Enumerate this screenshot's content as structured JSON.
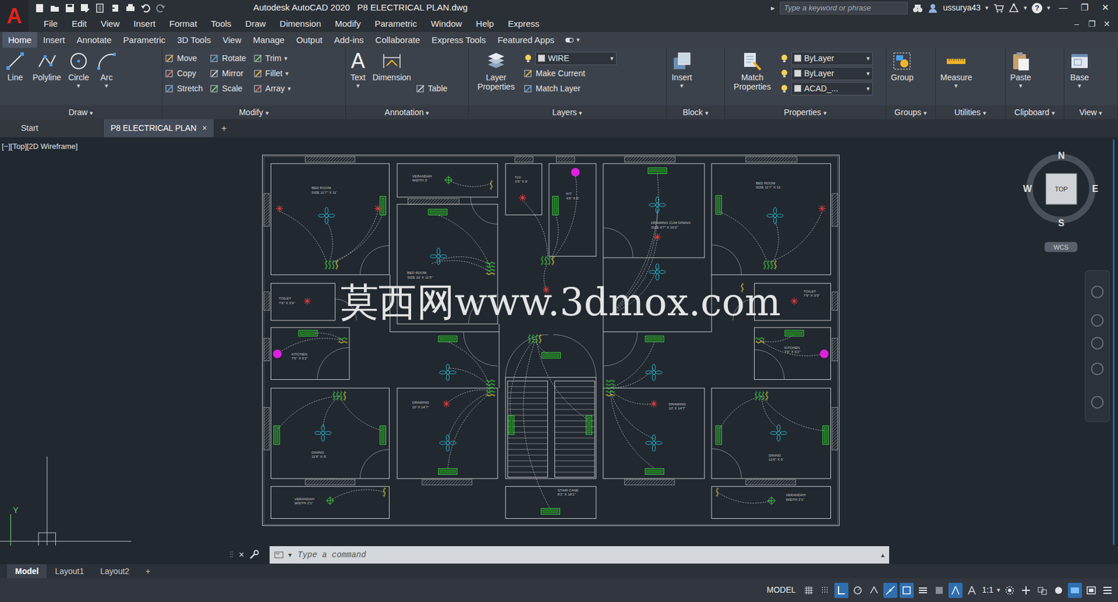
{
  "window": {
    "logo": "A",
    "title": "Autodesk AutoCAD 2020   P8 ELECTRICAL PLAN.dwg",
    "search_arrow": "▸",
    "search_placeholder": "Type a keyword or phrase",
    "user": "ussurya43",
    "help": "?",
    "controls": [
      "—",
      "❐",
      "✕"
    ]
  },
  "dropdown_glyph": "▾",
  "menu": {
    "items": [
      "File",
      "Edit",
      "View",
      "Insert",
      "Format",
      "Tools",
      "Draw",
      "Dimension",
      "Modify",
      "Parametric",
      "Window",
      "Help",
      "Express"
    ],
    "controls": [
      "–",
      "❐",
      "✕"
    ]
  },
  "ribbon_tabs": [
    {
      "label": "Home",
      "selected": true
    },
    {
      "label": "Insert",
      "selected": false
    },
    {
      "label": "Annotate",
      "selected": false
    },
    {
      "label": "Parametric",
      "selected": false
    },
    {
      "label": "3D Tools",
      "selected": false
    },
    {
      "label": "View",
      "selected": false
    },
    {
      "label": "Manage",
      "selected": false
    },
    {
      "label": "Output",
      "selected": false
    },
    {
      "label": "Add-ins",
      "selected": false
    },
    {
      "label": "Collaborate",
      "selected": false
    },
    {
      "label": "Express Tools",
      "selected": false
    },
    {
      "label": "Featured Apps",
      "selected": false
    }
  ],
  "ribbon_panels": [
    {
      "title": "Draw",
      "tools": [
        {
          "kind": "large",
          "label": "Line",
          "menu": false
        },
        {
          "kind": "large",
          "label": "Polyline",
          "menu": false
        },
        {
          "kind": "large",
          "label": "Circle",
          "menu": true
        },
        {
          "kind": "large",
          "label": "Arc",
          "menu": true
        }
      ]
    },
    {
      "title": "Modify",
      "tools": [
        {
          "kind": "small",
          "label": "Move",
          "menu": false
        },
        {
          "kind": "small",
          "label": "Rotate",
          "menu": false
        },
        {
          "kind": "small",
          "label": "Trim",
          "menu": true
        },
        {
          "kind": "small",
          "label": "Copy",
          "menu": false
        },
        {
          "kind": "small",
          "label": "Mirror",
          "menu": false
        },
        {
          "kind": "small",
          "label": "Fillet",
          "menu": true
        },
        {
          "kind": "small",
          "label": "Stretch",
          "menu": false
        },
        {
          "kind": "small",
          "label": "Scale",
          "menu": false
        },
        {
          "kind": "small",
          "label": "Array",
          "menu": true
        }
      ]
    },
    {
      "title": "Annotation",
      "tools": [
        {
          "kind": "large",
          "label": "Text",
          "glyph": "A",
          "menu": true
        },
        {
          "kind": "large",
          "label": "Dimension",
          "menu": false
        },
        {
          "kind": "small",
          "label": "Table",
          "menu": false
        }
      ]
    },
    {
      "title": "Layers",
      "tools": [
        {
          "kind": "large",
          "label": "Layer Properties",
          "menu": false
        },
        {
          "kind": "dropdown",
          "label": "WIRE",
          "menu": true
        },
        {
          "kind": "small",
          "label": "Make Current",
          "menu": false
        },
        {
          "kind": "small",
          "label": "Match Layer",
          "menu": false
        }
      ]
    },
    {
      "title": "Block",
      "tools": [
        {
          "kind": "large",
          "label": "Insert",
          "menu": true
        }
      ]
    },
    {
      "title": "Properties",
      "tools": [
        {
          "kind": "large",
          "label": "Match Properties",
          "menu": false
        },
        {
          "kind": "dropdown",
          "label": "ByLayer",
          "menu": true
        },
        {
          "kind": "dropdown",
          "label": "ByLayer",
          "menu": true
        },
        {
          "kind": "dropdown",
          "label": "ACAD_...",
          "menu": true
        }
      ]
    },
    {
      "title": "Groups",
      "tools": [
        {
          "kind": "large",
          "label": "Group",
          "menu": false
        }
      ]
    },
    {
      "title": "Utilities",
      "tools": [
        {
          "kind": "large",
          "label": "Measure",
          "menu": true
        }
      ]
    },
    {
      "title": "Clipboard",
      "tools": [
        {
          "kind": "large",
          "label": "Paste",
          "menu": true
        }
      ]
    },
    {
      "title": "View",
      "tools": [
        {
          "kind": "large",
          "label": "Base",
          "menu": true
        }
      ]
    }
  ],
  "doc_tabs": [
    {
      "label": "Start",
      "selected": false,
      "closable": false
    },
    {
      "label": "P8 ELECTRICAL PLAN",
      "selected": true,
      "closable": true
    }
  ],
  "doc_close": "×",
  "doc_add": "+",
  "viewport": {
    "label": "[−][Top][2D Wireframe]",
    "viewcube": {
      "n": "N",
      "s": "S",
      "e": "E",
      "w": "W",
      "face": "TOP",
      "ucs": "WCS"
    },
    "ucs_y": "Y",
    "watermark": "莫西网www.3dmox.com"
  },
  "plan": {
    "rooms": [
      {
        "name": "BED ROOM",
        "size": "SIZE 11'7\" X 11'"
      },
      {
        "name": "VERANDAH",
        "size": "WIDTH 3'"
      },
      {
        "name": "TOI",
        "size": "3'6\" X 6'"
      },
      {
        "name": "KIT",
        "size": "4'6\" X 6'"
      },
      {
        "name": "DRAWING CUM DINING",
        "size": "SIZE 9'7\" X 10'2\""
      },
      {
        "name": "BED ROOM",
        "size": "SIZE 10' X 11'5\""
      },
      {
        "name": "TOILET",
        "size": "7'6\" X 3'9\""
      },
      {
        "name": "KITCHEN",
        "size": "7'6\" X 6'2\""
      },
      {
        "name": "DRAWING",
        "size": "10' X 14'7\""
      },
      {
        "name": "DINING",
        "size": "11'6\" X 9'"
      },
      {
        "name": "VERANDAH",
        "size": "WIDTH 2'1\""
      },
      {
        "name": "STAIR CASE",
        "size": "8'2\" X 18'1\""
      },
      {
        "name": "BED ROOM",
        "size": "SIZE 11'7\" X 11'"
      },
      {
        "name": "TOILET",
        "size": "7'6\" X 3'9\""
      },
      {
        "name": "KITCHEN",
        "size": "7'6\" X 6'2\""
      },
      {
        "name": "DRAWING",
        "size": "10' X 14'7\""
      },
      {
        "name": "DINING",
        "size": "11'6\" X 9'"
      },
      {
        "name": "VERANDAH",
        "size": "WIDTH 3'1\""
      }
    ]
  },
  "command": {
    "close": "×",
    "placeholder": "Type a command",
    "expand": "▴"
  },
  "layout_tabs": [
    {
      "label": "Model",
      "selected": true
    },
    {
      "label": "Layout1",
      "selected": false
    },
    {
      "label": "Layout2",
      "selected": false
    }
  ],
  "layout_add": "+",
  "status": {
    "model": "MODEL",
    "scale": "1:1",
    "toggles": [
      {
        "on": false
      },
      {
        "on": false
      },
      {
        "on": true
      },
      {
        "on": false
      },
      {
        "on": false
      },
      {
        "on": true
      },
      {
        "on": true
      },
      {
        "on": false
      },
      {
        "on": false
      },
      {
        "on": true
      },
      {
        "on": false
      },
      {
        "on": false
      },
      {
        "on": false
      },
      {
        "on": false
      },
      {
        "on": false
      },
      {
        "on": true
      },
      {
        "on": false
      },
      {
        "on": false
      }
    ]
  }
}
